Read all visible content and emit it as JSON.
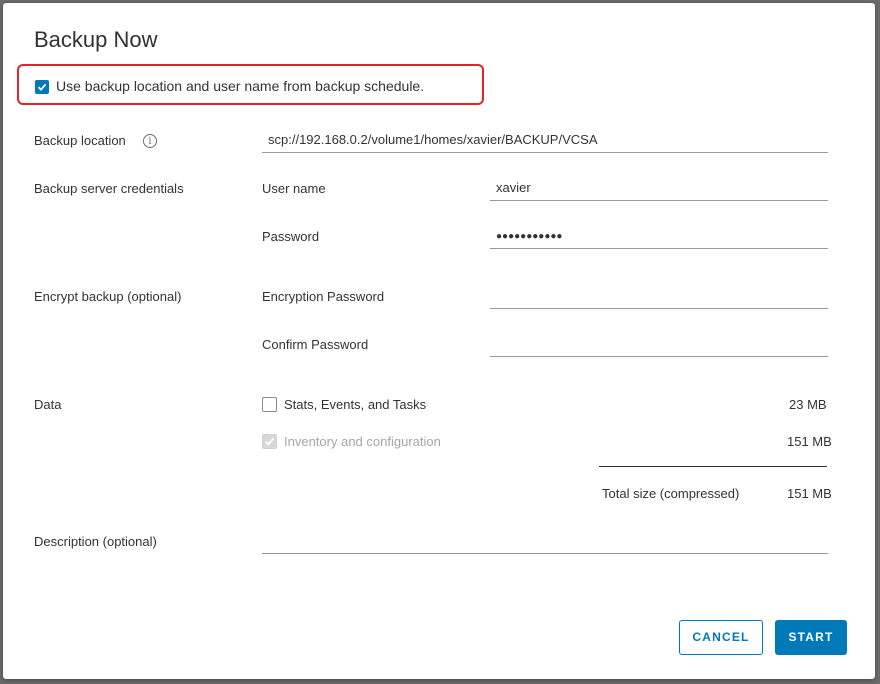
{
  "dialog": {
    "title": "Backup Now",
    "use_schedule": {
      "label": "Use backup location and user name from backup schedule.",
      "checked": true
    }
  },
  "location": {
    "label": "Backup location",
    "value": "scp://192.168.0.2/volume1/homes/xavier/BACKUP/VCSA"
  },
  "credentials": {
    "label": "Backup server credentials",
    "username_label": "User name",
    "username_value": "xavier",
    "password_label": "Password",
    "password_value": "●●●●●●●●●●●"
  },
  "encrypt": {
    "label": "Encrypt backup (optional)",
    "enc_password_label": "Encryption Password",
    "enc_password_value": "",
    "confirm_label": "Confirm Password",
    "confirm_value": ""
  },
  "data": {
    "label": "Data",
    "items": [
      {
        "label": "Stats, Events, and Tasks",
        "size": "23 MB",
        "checked": false,
        "disabled": false
      },
      {
        "label": "Inventory and configuration",
        "size": "151 MB",
        "checked": true,
        "disabled": true
      }
    ],
    "total_label": "Total size (compressed)",
    "total_value": "151 MB"
  },
  "description": {
    "label": "Description (optional)",
    "value": ""
  },
  "buttons": {
    "cancel": "CANCEL",
    "start": "START"
  },
  "colors": {
    "accent": "#0079b8",
    "highlight": "#e0262a"
  },
  "icons": {
    "info": "info-icon",
    "check": "checkmark-icon"
  }
}
